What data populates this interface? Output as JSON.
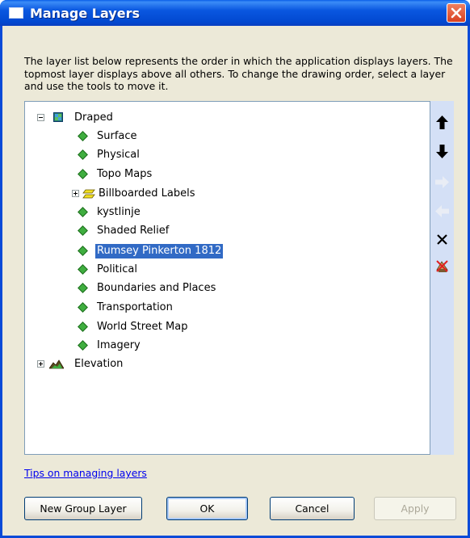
{
  "window": {
    "title": "Manage Layers"
  },
  "description": "The layer list below represents the order in which the application displays layers. The topmost layer displays above all others. To change the drawing order, select a layer and use the tools to move it.",
  "tree": {
    "groups": [
      {
        "label": "Draped",
        "expanded": true,
        "icon": "draped-group-icon"
      },
      {
        "label": "Elevation",
        "expanded": false,
        "icon": "elevation-group-icon"
      }
    ],
    "items": [
      {
        "label": "Surface",
        "icon": "layer-diamond-icon"
      },
      {
        "label": "Physical",
        "icon": "layer-diamond-icon"
      },
      {
        "label": "Topo Maps",
        "icon": "layer-diamond-icon"
      },
      {
        "label": "Billboarded Labels",
        "icon": "billboard-labels-icon",
        "expandable": true
      },
      {
        "label": "kystlinje",
        "icon": "layer-diamond-icon"
      },
      {
        "label": "Shaded Relief",
        "icon": "layer-diamond-icon"
      },
      {
        "label": "Rumsey Pinkerton 1812",
        "icon": "layer-diamond-icon",
        "selected": true
      },
      {
        "label": "Political",
        "icon": "layer-diamond-icon"
      },
      {
        "label": "Boundaries and Places",
        "icon": "layer-diamond-icon"
      },
      {
        "label": "Transportation",
        "icon": "layer-diamond-icon"
      },
      {
        "label": "World Street Map",
        "icon": "layer-diamond-icon"
      },
      {
        "label": "Imagery",
        "icon": "layer-diamond-icon"
      }
    ],
    "selected_color": "#316ac5"
  },
  "toolbar": {
    "tools": [
      {
        "name": "move-up-icon",
        "enabled": true
      },
      {
        "name": "move-down-icon",
        "enabled": true
      },
      {
        "name": "move-right-icon",
        "enabled": false
      },
      {
        "name": "move-left-icon",
        "enabled": false
      },
      {
        "name": "remove-icon",
        "enabled": true
      },
      {
        "name": "remove-all-icon",
        "enabled": true
      }
    ]
  },
  "tips_link": "Tips on managing layers",
  "buttons": {
    "new_group": "New Group Layer",
    "ok": "OK",
    "cancel": "Cancel",
    "apply": "Apply"
  },
  "colors": {
    "titlebar": "#0a57e0",
    "dialog_bg": "#ece9d8",
    "toolbar_bg": "#d4e0f6",
    "link": "#0000ee"
  }
}
